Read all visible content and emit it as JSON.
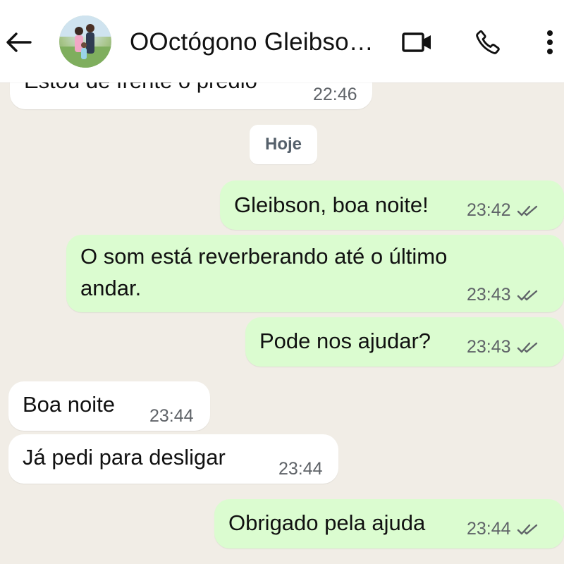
{
  "header": {
    "contact_name": "OOctógono Gleibso…",
    "icons": {
      "back": "arrow-left-icon",
      "avatar": "contact-photo",
      "video": "video-call-icon",
      "call": "phone-icon",
      "menu": "more-vertical-icon"
    }
  },
  "date_divider": "Hoje",
  "messages": [
    {
      "direction": "incoming",
      "text": "Estou de frente o prédio",
      "time": "22:46"
    },
    {
      "direction": "outgoing",
      "text": "Gleibson, boa noite!",
      "time": "23:42",
      "status": "read"
    },
    {
      "direction": "outgoing",
      "lines": [
        "O som está reverberando até o último",
        "andar."
      ],
      "time": "23:43",
      "status": "read"
    },
    {
      "direction": "outgoing",
      "text": "Pode nos ajudar?",
      "time": "23:43",
      "status": "read"
    },
    {
      "direction": "incoming",
      "text": "Boa noite",
      "time": "23:44"
    },
    {
      "direction": "incoming",
      "text": "Já pedi para desligar",
      "time": "23:44"
    },
    {
      "direction": "outgoing",
      "text": "Obrigado pela ajuda",
      "time": "23:44",
      "status": "read"
    }
  ],
  "colors": {
    "chat_background": "#f1ede6",
    "incoming_bubble": "#ffffff",
    "outgoing_bubble": "#dbfcd0",
    "timestamp": "#5f6368",
    "read_ticks": "#5f6368"
  }
}
